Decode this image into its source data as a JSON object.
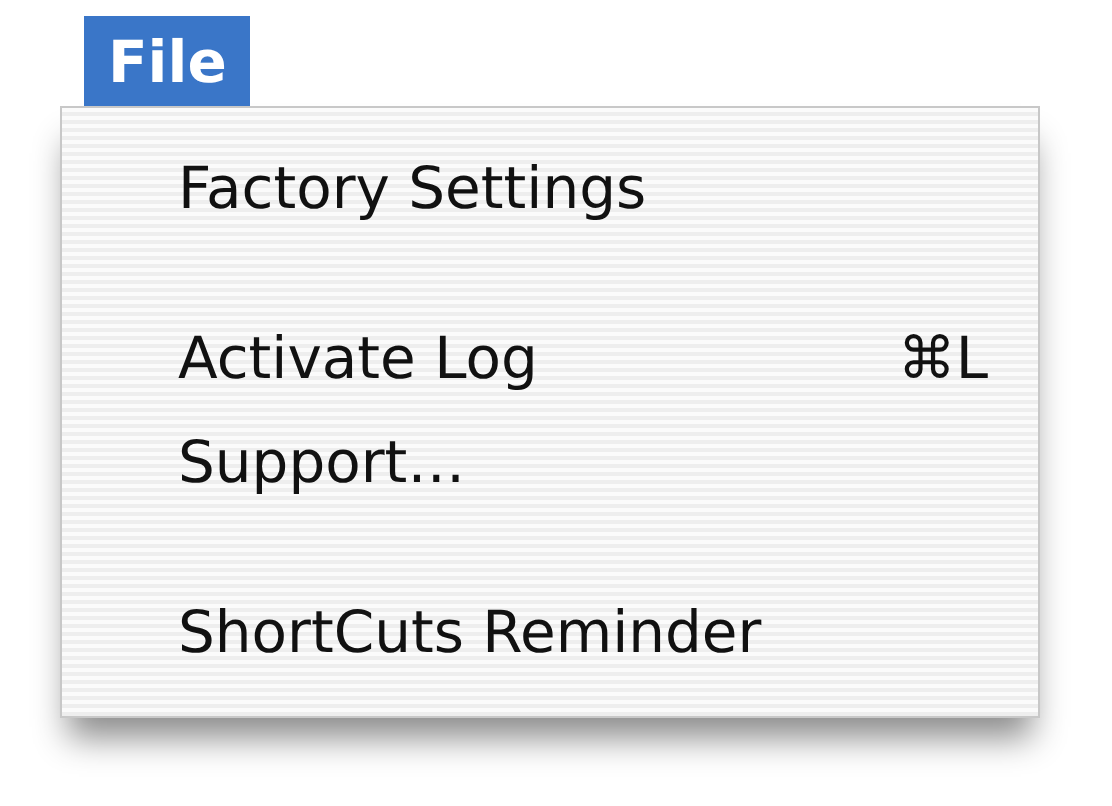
{
  "menu_bar": {
    "title": "File",
    "selected": true
  },
  "menu": {
    "items": [
      {
        "kind": "item",
        "label": "Factory Settings"
      },
      {
        "kind": "separator"
      },
      {
        "kind": "item",
        "label": "Activate Log",
        "shortcut": "⌘L"
      },
      {
        "kind": "item",
        "label": "Support…"
      },
      {
        "kind": "separator"
      },
      {
        "kind": "item",
        "label": "ShortCuts Reminder"
      }
    ]
  }
}
